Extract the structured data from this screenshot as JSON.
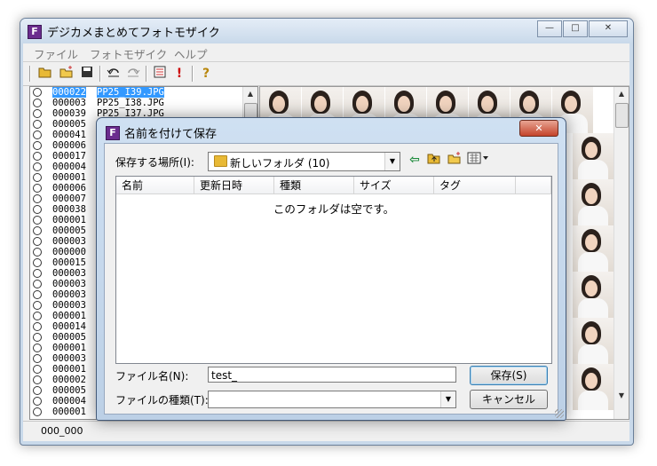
{
  "window": {
    "title": "デジカメまとめてフォトモザイク",
    "app_icon_letter": "F",
    "controls": {
      "minimize": "—",
      "maximize": "□",
      "close": "✕"
    }
  },
  "menu": [
    "ファイル",
    "フォトモザイク",
    "ヘルプ"
  ],
  "toolbar_icons": [
    "open-folder-icon",
    "new-folder-icon",
    "save-icon",
    "undo-icon",
    "redo-icon",
    "list-icon",
    "exclamation-icon",
    "help-icon"
  ],
  "file_list": {
    "rows": [
      {
        "num": "000022",
        "name": "PP25_I39.JPG",
        "selected": true
      },
      {
        "num": "000003",
        "name": "PP25_I38.JPG"
      },
      {
        "num": "000039",
        "name": "PP25_I37.JPG"
      },
      {
        "num": "000005",
        "name": ""
      },
      {
        "num": "000041",
        "name": ""
      },
      {
        "num": "000006",
        "name": ""
      },
      {
        "num": "000017",
        "name": ""
      },
      {
        "num": "000004",
        "name": ""
      },
      {
        "num": "000001",
        "name": ""
      },
      {
        "num": "000006",
        "name": ""
      },
      {
        "num": "000007",
        "name": ""
      },
      {
        "num": "000038",
        "name": ""
      },
      {
        "num": "000001",
        "name": ""
      },
      {
        "num": "000005",
        "name": ""
      },
      {
        "num": "000003",
        "name": ""
      },
      {
        "num": "000000",
        "name": ""
      },
      {
        "num": "000015",
        "name": ""
      },
      {
        "num": "000003",
        "name": ""
      },
      {
        "num": "000003",
        "name": ""
      },
      {
        "num": "000003",
        "name": ""
      },
      {
        "num": "000003",
        "name": ""
      },
      {
        "num": "000001",
        "name": ""
      },
      {
        "num": "000014",
        "name": ""
      },
      {
        "num": "000005",
        "name": ""
      },
      {
        "num": "000001",
        "name": ""
      },
      {
        "num": "000003",
        "name": ""
      },
      {
        "num": "000001",
        "name": ""
      },
      {
        "num": "000002",
        "name": ""
      },
      {
        "num": "000005",
        "name": ""
      },
      {
        "num": "000004",
        "name": ""
      },
      {
        "num": "000001",
        "name": ""
      }
    ]
  },
  "status": {
    "text": "000_000"
  },
  "dialog": {
    "title": "名前を付けて保存",
    "icon_letter": "F",
    "close_label": "✕",
    "save_in_label": "保存する場所(I):",
    "save_in_value": "新しいフォルダ (10)",
    "columns": [
      "名前",
      "更新日時",
      "種類",
      "サイズ",
      "タグ"
    ],
    "empty_message": "このフォルダは空です。",
    "filename_label": "ファイル名(N):",
    "filename_value": "test_",
    "filetype_label": "ファイルの種類(T):",
    "filetype_value": "",
    "save_button": "保存(S)",
    "cancel_button": "キャンセル"
  }
}
